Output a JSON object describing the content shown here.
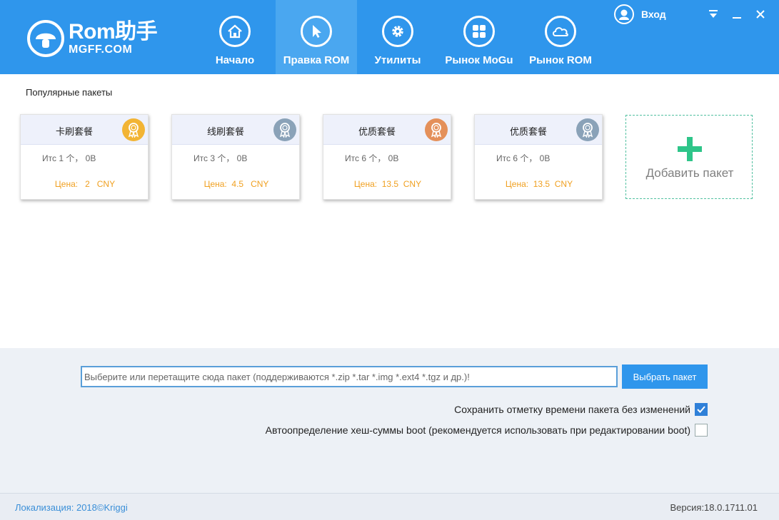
{
  "colors": {
    "header_blue": "#2f96ec",
    "active_tab": "#4aa7f0",
    "price_orange": "#f0a020",
    "add_green": "#2ec589"
  },
  "logo": {
    "title": "Rom助手",
    "subtitle": "MGFF.COM"
  },
  "nav": [
    {
      "label": "Начало",
      "icon": "home-icon"
    },
    {
      "label": "Правка ROM",
      "icon": "cursor-icon",
      "active": true
    },
    {
      "label": "Утилиты",
      "icon": "gear-icon"
    },
    {
      "label": "Рынок MoGu",
      "icon": "grid-icon"
    },
    {
      "label": "Рынок ROM",
      "icon": "cloud-icon"
    }
  ],
  "login": {
    "label": "Вход",
    "icon": "user-icon"
  },
  "section": {
    "title": "Популярные пакеты"
  },
  "cards": [
    {
      "name": "卡刷套餐",
      "count": "Итс 1 个， 0B",
      "price": "Цена:   2   CNY",
      "badge_color": "#f2b434"
    },
    {
      "name": "线刷套餐",
      "count": "Итс 3 个， 0B",
      "price": "Цена:  4.5   CNY",
      "badge_color": "#8aa2b8"
    },
    {
      "name": "优质套餐",
      "count": "Итс 6 个， 0B",
      "price": "Цена:  13.5  CNY",
      "badge_color": "#e4905a"
    },
    {
      "name": "优质套餐",
      "count": "Итс 6 个， 0B",
      "price": "Цена:  13.5  CNY",
      "badge_color": "#8aa2b8"
    }
  ],
  "add_card": {
    "label": "Добавить пакет"
  },
  "file": {
    "placeholder": "Выберите или перетащите сюда пакет (поддерживаются *.zip *.tar *.img *.ext4 *.tgz и др.)!",
    "button": "Выбрать пакет"
  },
  "options": [
    {
      "label": "Сохранить отметку времени пакета без изменений",
      "checked": true
    },
    {
      "label": "Автоопределение хеш-суммы boot (рекомендуется использовать при редактировании boot)",
      "checked": false
    }
  ],
  "footer": {
    "localization": "Локализация: 2018©Kriggi",
    "version": "Версия:18.0.1711.01"
  }
}
